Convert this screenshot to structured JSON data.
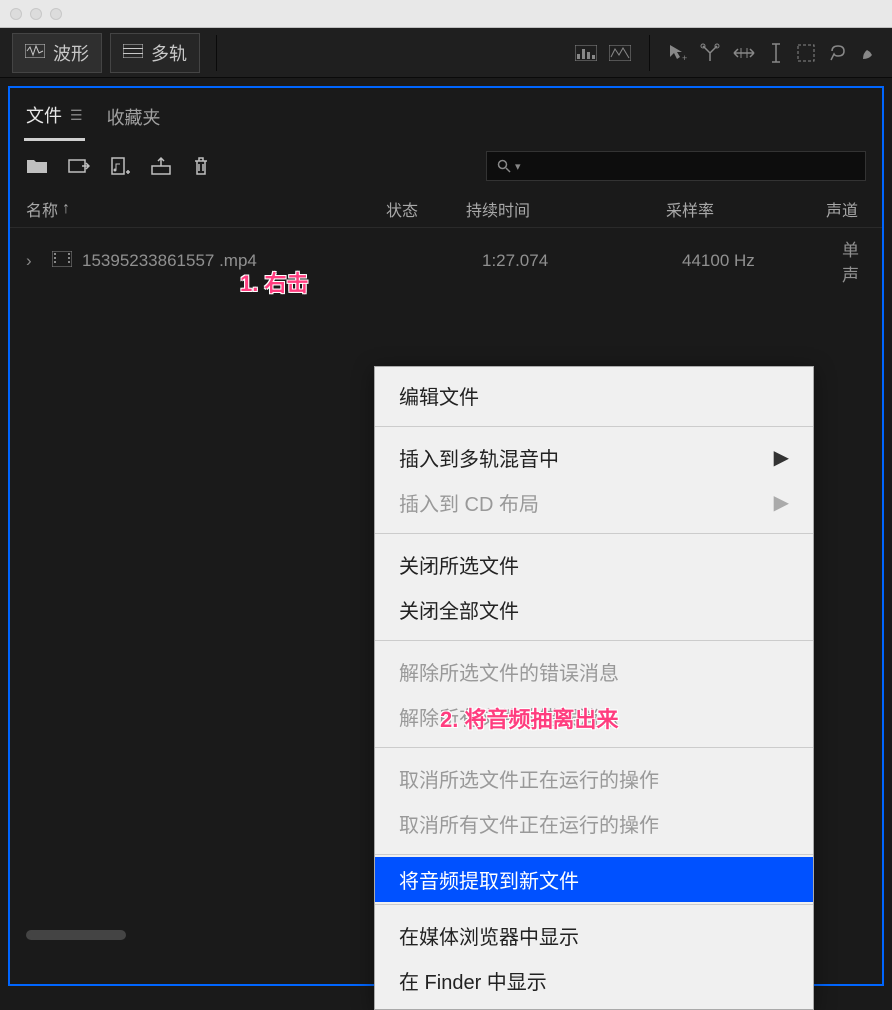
{
  "toolbar": {
    "waveform": "波形",
    "multitrack": "多轨"
  },
  "panel": {
    "tabs": {
      "files": "文件",
      "favorites": "收藏夹"
    },
    "search_placeholder": "",
    "columns": {
      "name": "名称",
      "status": "状态",
      "duration": "持续时间",
      "sample_rate": "采样率",
      "channels": "声道"
    },
    "sort_arrow": "↑"
  },
  "files": [
    {
      "name": "15395233861557 .mp4",
      "duration": "1:27.074",
      "sample_rate": "44100 Hz",
      "channels": "单声"
    }
  ],
  "annotations": {
    "a1": "1. 右击",
    "a2": "2. 将音频抽离出来"
  },
  "context_menu": {
    "edit_file": "编辑文件",
    "insert_multitrack": "插入到多轨混音中",
    "insert_cd": "插入到 CD 布局",
    "close_selected": "关闭所选文件",
    "close_all": "关闭全部文件",
    "clear_selected_errors": "解除所选文件的错误消息",
    "clear_all_errors": "解除所有文件的错误消息",
    "cancel_selected_ops": "取消所选文件正在运行的操作",
    "cancel_all_ops": "取消所有文件正在运行的操作",
    "extract_audio": "将音频提取到新文件",
    "show_in_browser": "在媒体浏览器中显示",
    "show_in_finder": "在 Finder 中显示"
  }
}
